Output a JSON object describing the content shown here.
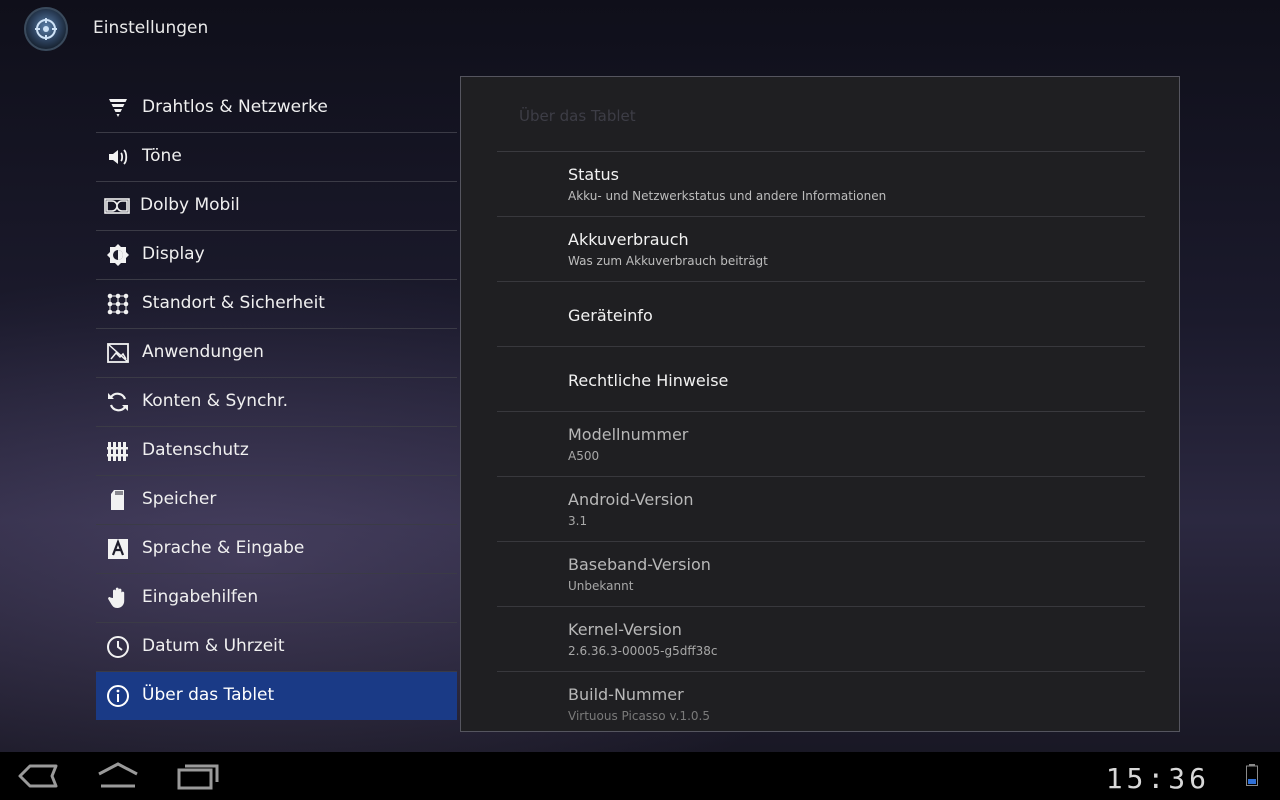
{
  "app": {
    "title": "Einstellungen",
    "icon": "settings-app-icon"
  },
  "sidebar": {
    "selected_index": 12,
    "items": [
      {
        "label": "Drahtlos & Netzwerke",
        "icon": "wifi-icon"
      },
      {
        "label": "Töne",
        "icon": "speaker-icon"
      },
      {
        "label": "Dolby Mobil",
        "icon": "dolby-icon"
      },
      {
        "label": "Display",
        "icon": "brightness-icon"
      },
      {
        "label": "Standort & Sicherheit",
        "icon": "location-security-icon"
      },
      {
        "label": "Anwendungen",
        "icon": "applications-icon"
      },
      {
        "label": "Konten & Synchr.",
        "icon": "sync-icon"
      },
      {
        "label": "Datenschutz",
        "icon": "privacy-icon"
      },
      {
        "label": "Speicher",
        "icon": "sd-card-icon"
      },
      {
        "label": "Sprache & Eingabe",
        "icon": "language-icon"
      },
      {
        "label": "Eingabehilfen",
        "icon": "hand-icon"
      },
      {
        "label": "Datum & Uhrzeit",
        "icon": "clock-icon"
      },
      {
        "label": "Über das Tablet",
        "icon": "info-icon"
      }
    ]
  },
  "panel": {
    "header": "Über das Tablet",
    "items": [
      {
        "title": "Status",
        "summary": "Akku- und Netzwerkstatus und andere Informationen"
      },
      {
        "title": "Akkuverbrauch",
        "summary": "Was zum Akkuverbrauch beiträgt"
      },
      {
        "title": "Geräteinfo",
        "summary": ""
      },
      {
        "title": "Rechtliche Hinweise",
        "summary": ""
      },
      {
        "title": "Modellnummer",
        "summary": "A500"
      },
      {
        "title": "Android-Version",
        "summary": "3.1"
      },
      {
        "title": "Baseband-Version",
        "summary": "Unbekannt"
      },
      {
        "title": "Kernel-Version",
        "summary": "2.6.36.3-00005-g5dff38c"
      },
      {
        "title": "Build-Nummer",
        "summary": "Virtuous Picasso v.1.0.5"
      }
    ]
  },
  "navbar": {
    "time": "15:36",
    "buttons": [
      "back-icon",
      "home-icon",
      "recent-apps-icon"
    ],
    "status_icons": [
      "battery-icon"
    ]
  },
  "colors": {
    "selected_bg": "#1a3a86",
    "panel_bg": "#1f1f22",
    "navbar_bg": "#000000"
  }
}
